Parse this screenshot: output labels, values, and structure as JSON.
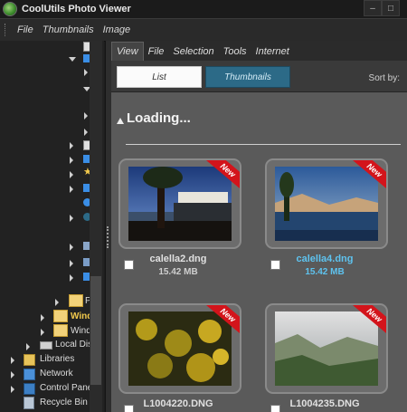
{
  "window": {
    "title": "CoolUtils Photo Viewer"
  },
  "menu": [
    "File",
    "Thumbnails",
    "Image"
  ],
  "tree": {
    "items": [
      {
        "label": "P",
        "bold": false
      },
      {
        "label": "Wind",
        "bold": true
      },
      {
        "label": "Wind",
        "bold": false
      },
      {
        "label": "Local Dis",
        "bold": false
      },
      {
        "label": "Libraries",
        "bold": false
      },
      {
        "label": "Network",
        "bold": false
      },
      {
        "label": "Control Pane",
        "bold": false
      },
      {
        "label": "Recycle Bin",
        "bold": false
      }
    ]
  },
  "panel": {
    "tabs": [
      "View",
      "File",
      "Selection",
      "Tools",
      "Internet"
    ],
    "list_label": "List",
    "thumbnails_label": "Thumbnails",
    "sort_label": "Sort by:",
    "loading_label": "Loading...",
    "ribbon_label": "New",
    "files": [
      {
        "name": "calella2.dng",
        "size": "15.42 MB",
        "selected": false
      },
      {
        "name": "calella4.dng",
        "size": "15.42 MB",
        "selected": true
      },
      {
        "name": "L1004220.DNG",
        "size": "",
        "selected": false
      },
      {
        "name": "L1004235.DNG",
        "size": "",
        "selected": false
      }
    ]
  },
  "colors": {
    "accent": "#2c6a87",
    "selected_text": "#5ec3ef",
    "ribbon": "#d3141b"
  }
}
